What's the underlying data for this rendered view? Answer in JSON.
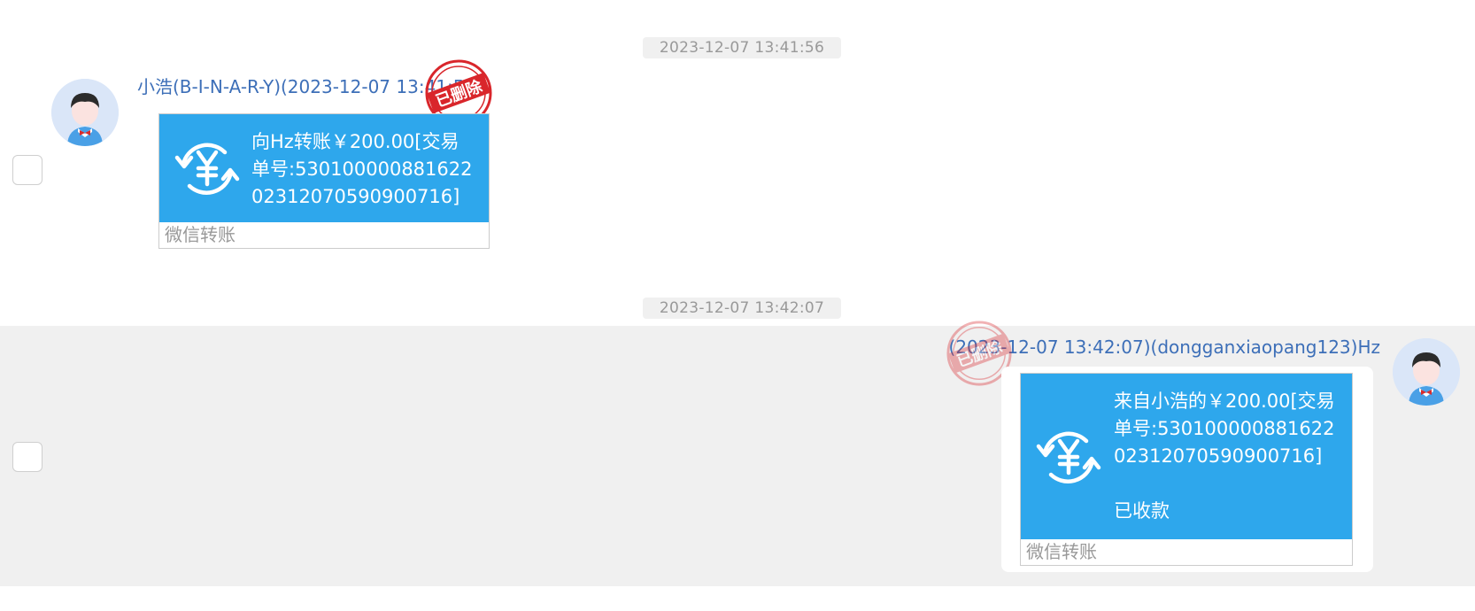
{
  "messages": [
    {
      "timestamp": "2023-12-07 13:41:56",
      "sender_line": "小浩(B-I-N-A-R-Y)(2023-12-07 13:41:56)",
      "stamp_text": "已删除",
      "card_text": "向Hz转账￥200.00[交易单号:53010000088162202312070590900716]",
      "card_footer": "微信转账",
      "icon": "yuan-transfer-icon"
    },
    {
      "timestamp": "2023-12-07 13:42:07",
      "sender_line": "(2023-12-07 13:42:07)(dongganxiaopang123)Hz",
      "stamp_text": "已删除",
      "card_text": "来自小浩的￥200.00[交易单号:53010000088162202312070590900716]",
      "card_status": "已收款",
      "card_footer": "微信转账",
      "icon": "yuan-transfer-icon"
    }
  ],
  "colors": {
    "card_blue": "#2ea7ec",
    "name_blue": "#3d6fb8",
    "stamp_red": "#d9262b",
    "row_highlight": "#f0f0f0"
  }
}
